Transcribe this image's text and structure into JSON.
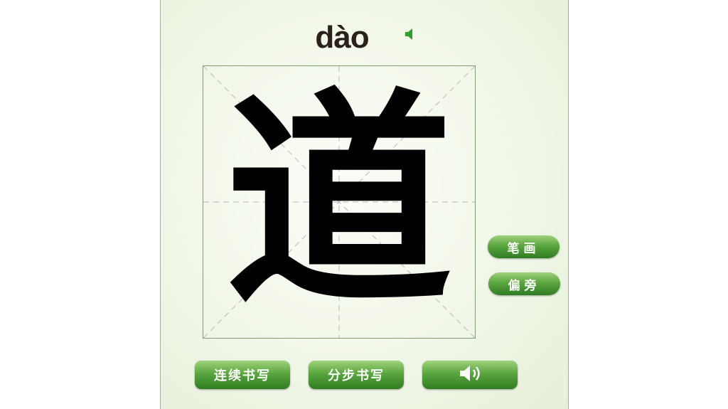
{
  "pinyin": "dào",
  "character": "道",
  "side_buttons": {
    "strokes_label": "笔画",
    "radical_label": "偏旁"
  },
  "bottom_buttons": {
    "continuous_label": "连续书写",
    "step_label": "分步书写",
    "sound_icon": "speaker-icon"
  },
  "colors": {
    "button_green": "#5aa63e",
    "background": "#f1f7e8",
    "grid_line": "#7f9d72"
  }
}
